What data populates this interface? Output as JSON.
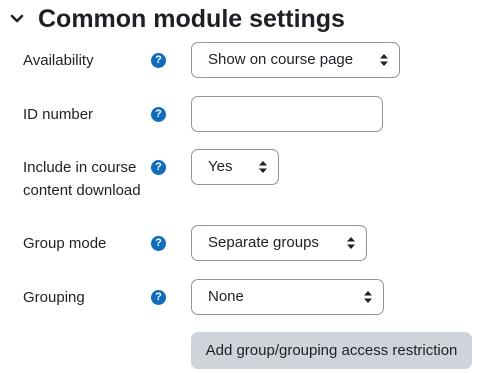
{
  "section": {
    "title": "Common module settings"
  },
  "fields": {
    "availability": {
      "label": "Availability",
      "value": "Show on course page"
    },
    "id_number": {
      "label": "ID number",
      "value": ""
    },
    "content_download": {
      "label_line1": "Include in course",
      "label_line2": "content download",
      "value": "Yes"
    },
    "group_mode": {
      "label": "Group mode",
      "value": "Separate groups"
    },
    "grouping": {
      "label": "Grouping",
      "value": "None"
    }
  },
  "help_icon_glyph": "?",
  "buttons": {
    "add_restriction": "Add group/grouping access restriction"
  },
  "colors": {
    "help_icon": "#0f6cbf",
    "button_bg": "#ced4da",
    "border": "#8f959e",
    "text": "#1d2125"
  },
  "icons": {
    "collapse": "chevron-down-icon",
    "help": "question-circle-icon",
    "select": "sort-arrows-icon"
  }
}
